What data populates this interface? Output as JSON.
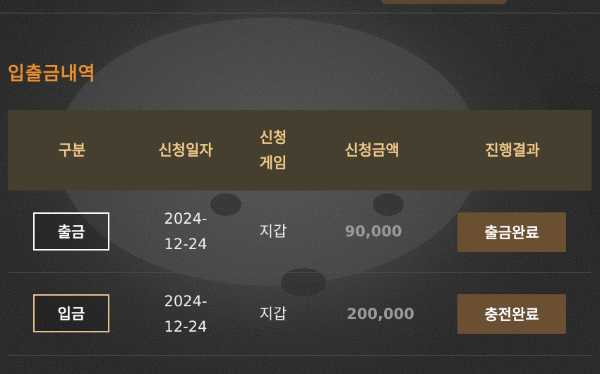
{
  "page": {
    "section_title": "입출금내역"
  },
  "table": {
    "headers": {
      "type": "구분",
      "date": "신청일자",
      "game_line1": "신청",
      "game_line2": "게임",
      "amount": "신청금액",
      "result": "진행결과"
    },
    "rows": [
      {
        "type": "출금",
        "date_line1": "2024-",
        "date_line2": "12-24",
        "game": "지갑",
        "amount": "90,000",
        "result": "출금완료"
      },
      {
        "type": "입금",
        "date_line1": "2024-",
        "date_line2": "12-24",
        "game": "지갑",
        "amount": "200,000",
        "result": "충전완료"
      }
    ]
  },
  "colors": {
    "title_accent": "#e8902c",
    "header_bg": "#463f2f",
    "header_text": "#efc98b",
    "status_button_bg": "#6b4f33",
    "withdraw_badge_border": "#ffffff",
    "deposit_badge_border": "#e9c28c"
  }
}
